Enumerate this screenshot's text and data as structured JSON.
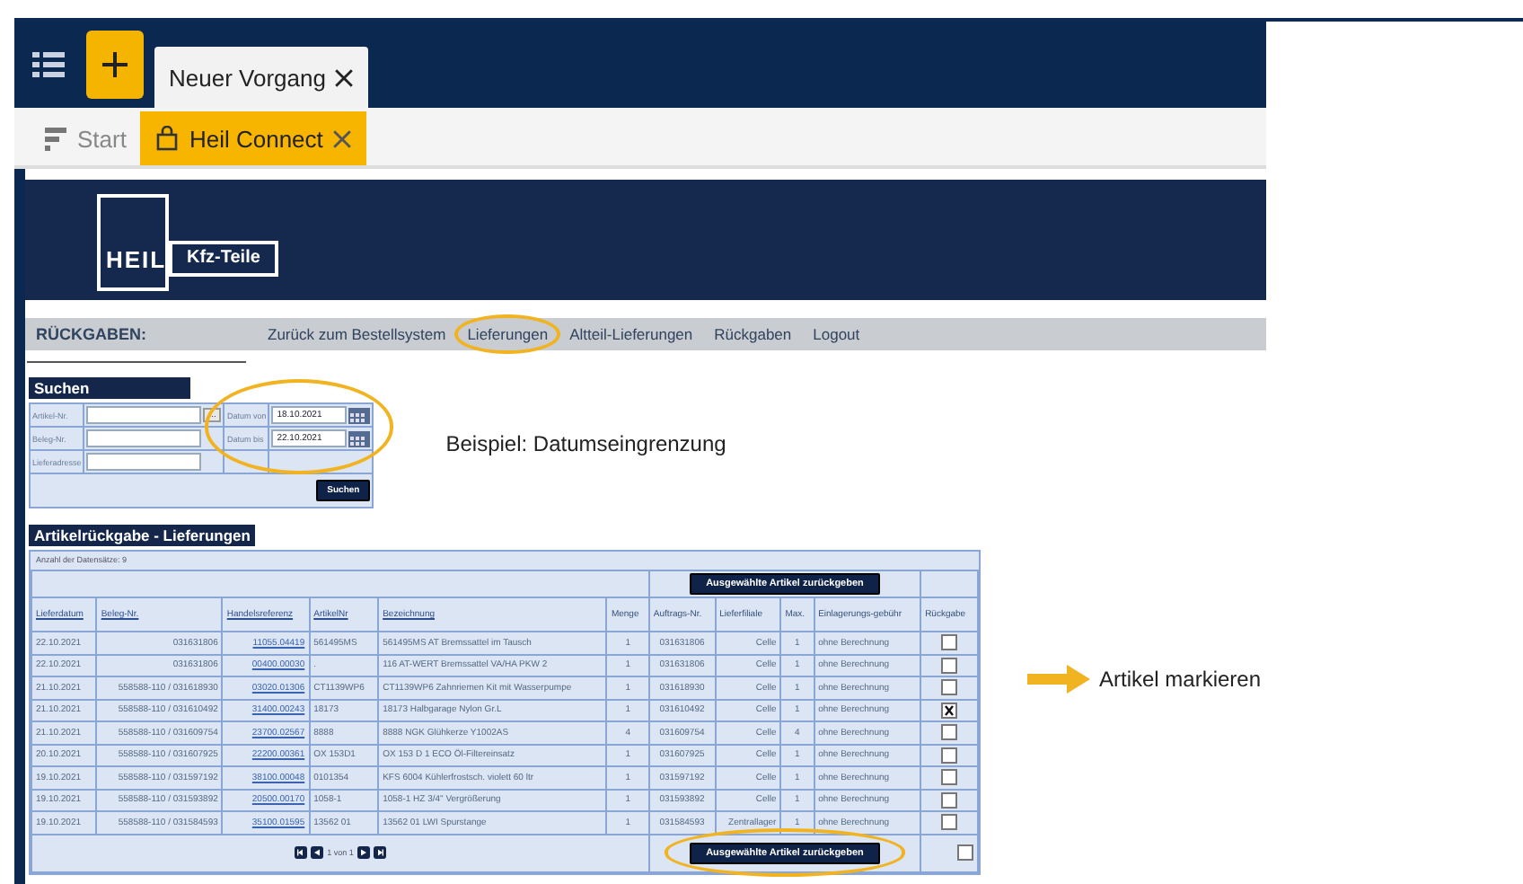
{
  "app_bar": {
    "tabs": [
      {
        "label": "Neuer Vorgang",
        "selected": true
      }
    ]
  },
  "sub_tabs": [
    {
      "label": "Start",
      "selected": false,
      "kind": "home"
    },
    {
      "label": "Heil Connect",
      "selected": true,
      "kind": "shop"
    }
  ],
  "header": {
    "logo_mark": "HEIL",
    "logo_text": "Kfz-Teile"
  },
  "nav": {
    "title": "RÜCKGABEN:",
    "items": [
      {
        "label": "Zurück zum Bestellsystem"
      },
      {
        "label": "Lieferungen"
      },
      {
        "label": "Altteil-Lieferungen"
      },
      {
        "label": "Rückgaben"
      },
      {
        "label": "Logout"
      }
    ]
  },
  "search": {
    "title": "Suchen",
    "fields": [
      {
        "label": "Artikel-Nr.",
        "kind": "lookup",
        "button": "..."
      },
      {
        "label": "Datum von",
        "kind": "date",
        "value": "18.10.2021"
      },
      {
        "label": "Beleg-Nr.",
        "kind": "text"
      },
      {
        "label": "Datum bis",
        "kind": "date",
        "value": "22.10.2021"
      },
      {
        "label": "Lieferadresse",
        "kind": "text"
      }
    ],
    "button": "Suchen"
  },
  "results": {
    "title": "Artikelrückgabe - Lieferungen",
    "count": "Anzahl der Datensätze: 9",
    "top_button": "Ausgewählte Artikel zurückgeben",
    "bottom_button": "Ausgewählte Artikel zurückgeben",
    "columns": [
      {
        "label": "Lieferdatum",
        "sortable": true
      },
      {
        "label": "Beleg-Nr.",
        "sortable": true
      },
      {
        "label": "Handelsreferenz",
        "sortable": true
      },
      {
        "label": "ArtikelNr",
        "sortable": true
      },
      {
        "label": "Bezeichnung",
        "sortable": true
      },
      {
        "label": "Menge",
        "sortable": false
      },
      {
        "label": "Auftrags-Nr.",
        "sortable": false
      },
      {
        "label": "Lieferfiliale",
        "sortable": false
      },
      {
        "label": "Max.",
        "sortable": false
      },
      {
        "label": "Einlagerungs-gebühr",
        "sortable": false
      },
      {
        "label": "Rückgabe",
        "sortable": false
      }
    ],
    "rows": [
      {
        "cells": [
          "22.10.2021",
          "031631806",
          "11055.04419",
          "561495MS",
          "561495MS AT  Bremssattel im Tausch",
          "1",
          "031631806",
          "Celle",
          "1",
          "ohne Berechnung"
        ],
        "returned": false
      },
      {
        "cells": [
          "22.10.2021",
          "031631806",
          "00400.00030",
          ".",
          "116 AT-WERT  Bremssattel VA/HA PKW 2",
          "1",
          "031631806",
          "Celle",
          "1",
          "ohne Berechnung"
        ],
        "returned": false
      },
      {
        "cells": [
          "21.10.2021",
          "558588-110 / 031618930",
          "03020.01306",
          "CT1139WP6",
          "CT1139WP6  Zahnriemen Kit mit Wasserpumpe",
          "1",
          "031618930",
          "Celle",
          "1",
          "ohne Berechnung"
        ],
        "returned": false
      },
      {
        "cells": [
          "21.10.2021",
          "558588-110 / 031610492",
          "31400.00243",
          "18173",
          "18173  Halbgarage Nylon Gr.L",
          "1",
          "031610492",
          "Celle",
          "1",
          "ohne Berechnung"
        ],
        "returned": true
      },
      {
        "cells": [
          "21.10.2021",
          "558588-110 / 031609754",
          "23700.02567",
          "8888",
          "8888 NGK  Glühkerze Y1002AS",
          "4",
          "031609754",
          "Celle",
          "4",
          "ohne Berechnung"
        ],
        "returned": false
      },
      {
        "cells": [
          "20.10.2021",
          "558588-110 / 031607925",
          "22200.00361",
          "OX 153D1",
          "OX 153 D 1 ECO  Öl-Filtereinsatz",
          "1",
          "031607925",
          "Celle",
          "1",
          "ohne Berechnung"
        ],
        "returned": false
      },
      {
        "cells": [
          "19.10.2021",
          "558588-110 / 031597192",
          "38100.00048",
          "0101354",
          "KFS 6004  Kühlerfrostsch. violett 60 ltr",
          "1",
          "031597192",
          "Celle",
          "1",
          "ohne Berechnung"
        ],
        "returned": false
      },
      {
        "cells": [
          "19.10.2021",
          "558588-110 / 031593892",
          "20500.00170",
          "1058-1",
          "1058-1 HZ  3/4\"  Vergrößerung",
          "1",
          "031593892",
          "Celle",
          "1",
          "ohne Berechnung"
        ],
        "returned": false
      },
      {
        "cells": [
          "19.10.2021",
          "558588-110 / 031584593",
          "35100.01595",
          "13562 01",
          "13562 01 LWI  Spurstange",
          "1",
          "031584593",
          "Zentrallager",
          "1",
          "ohne Berechnung"
        ],
        "returned": false
      }
    ],
    "footer_checked": false,
    "pagination": "1 von 1"
  },
  "annotations": [
    {
      "kind": "note",
      "text": "Beispiel: Datumseingrenzung"
    },
    {
      "kind": "arrow-note",
      "text": "Artikel markieren"
    }
  ]
}
